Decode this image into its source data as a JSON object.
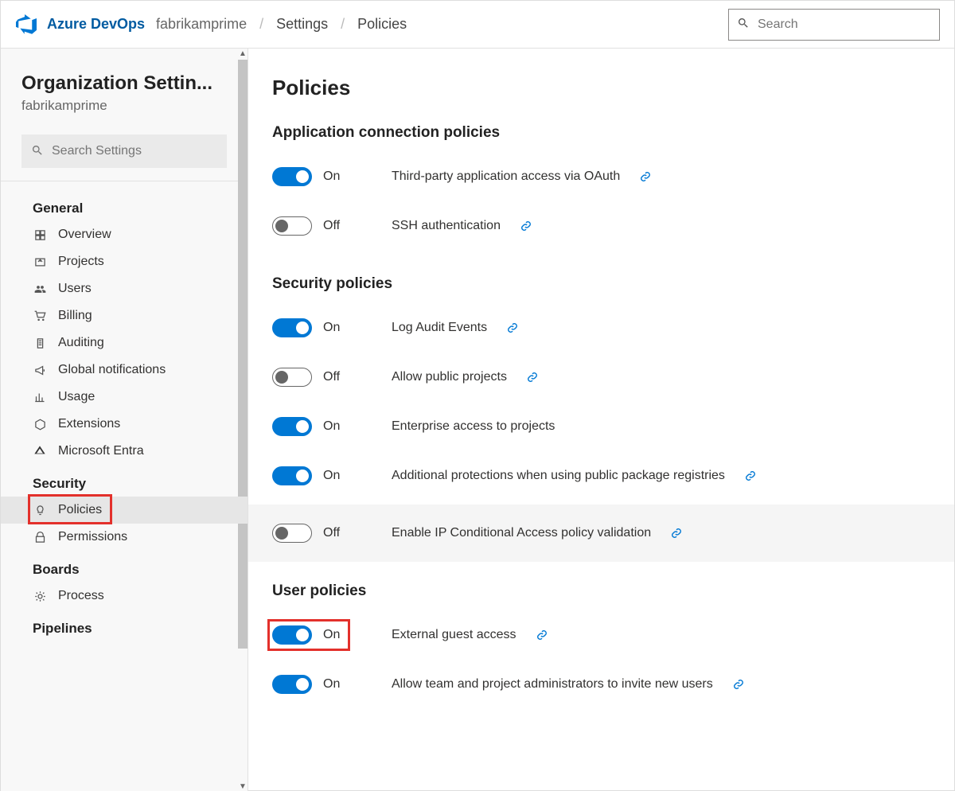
{
  "header": {
    "brand": "Azure DevOps",
    "org": "fabrikamprime",
    "crumbs": [
      "Settings",
      "Policies"
    ],
    "search_placeholder": "Search"
  },
  "sidebar": {
    "title": "Organization Settin...",
    "subtitle": "fabrikamprime",
    "search_placeholder": "Search Settings",
    "sections": {
      "general": {
        "label": "General",
        "items": [
          "Overview",
          "Projects",
          "Users",
          "Billing",
          "Auditing",
          "Global notifications",
          "Usage",
          "Extensions",
          "Microsoft Entra"
        ]
      },
      "security": {
        "label": "Security",
        "items": [
          "Policies",
          "Permissions"
        ]
      },
      "boards": {
        "label": "Boards",
        "items": [
          "Process"
        ]
      },
      "pipelines": {
        "label": "Pipelines"
      }
    }
  },
  "main": {
    "title": "Policies",
    "groups": [
      {
        "title": "Application connection policies",
        "policies": [
          {
            "state": true,
            "label": "Third-party application access via OAuth",
            "link": true
          },
          {
            "state": false,
            "label": "SSH authentication",
            "link": true
          }
        ]
      },
      {
        "title": "Security policies",
        "policies": [
          {
            "state": true,
            "label": "Log Audit Events",
            "link": true
          },
          {
            "state": false,
            "label": "Allow public projects",
            "link": true
          },
          {
            "state": true,
            "label": "Enterprise access to projects",
            "link": false
          },
          {
            "state": true,
            "label": "Additional protections when using public package registries",
            "link": true
          },
          {
            "state": false,
            "label": "Enable IP Conditional Access policy validation",
            "link": true,
            "hover": true
          }
        ]
      },
      {
        "title": "User policies",
        "policies": [
          {
            "state": true,
            "label": "External guest access",
            "link": true,
            "highlight": true
          },
          {
            "state": true,
            "label": "Allow team and project administrators to invite new users",
            "link": true
          }
        ]
      }
    ],
    "on_label": "On",
    "off_label": "Off"
  }
}
